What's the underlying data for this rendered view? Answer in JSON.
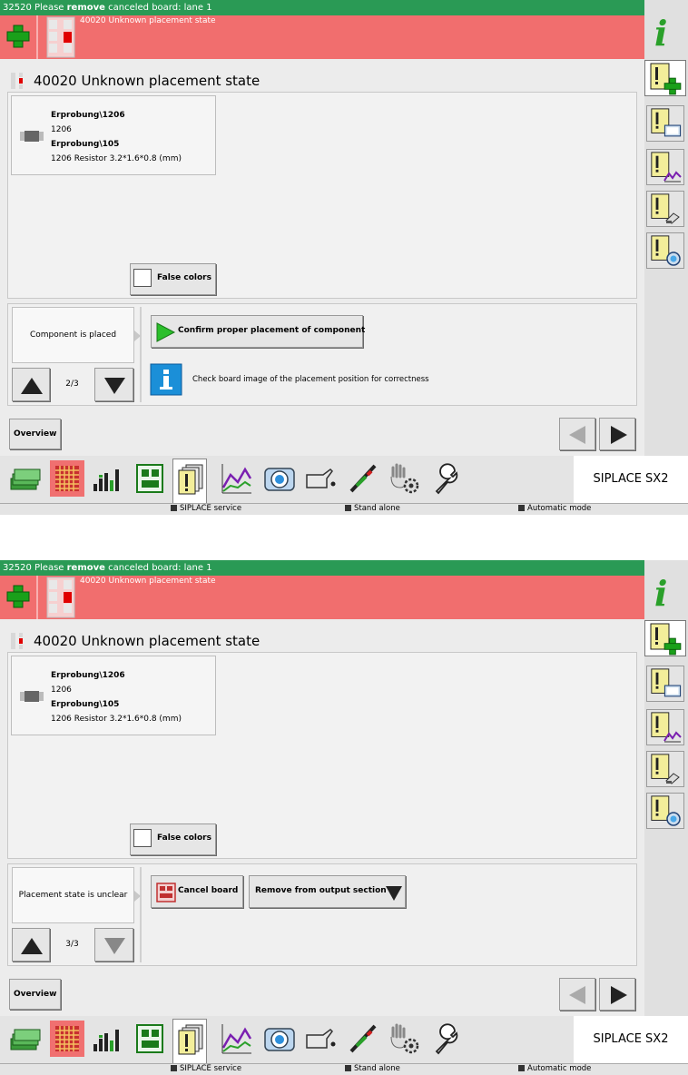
{
  "screens": [
    {
      "top_message": {
        "prefix": "32520 Please ",
        "bold": "remove",
        "suffix": " canceled board: lane 1"
      },
      "error_message": "40020 Unknown placement state",
      "title": "40020 Unknown placement state",
      "component": {
        "line1": "Erprobung\\1206",
        "line2": "1206",
        "line3": "Erprobung\\105",
        "line4": "1206 Resistor  3.2*1.6*0.8 (mm)"
      },
      "false_colors_label": "False colors",
      "state_text": "Component is placed",
      "pager": "2/3",
      "confirm_label": "Confirm proper placement of component",
      "check_text": "Check board image of the placement position for correctness",
      "overview_label": "Overview",
      "brand": "SIPLACE SX2",
      "status": [
        "SIPLACE service",
        "Stand alone",
        "Automatic mode"
      ]
    },
    {
      "top_message": {
        "prefix": "32520 Please ",
        "bold": "remove",
        "suffix": " canceled board: lane 1"
      },
      "error_message": "40020 Unknown placement state",
      "title": "40020 Unknown placement state",
      "component": {
        "line1": "Erprobung\\1206",
        "line2": "1206",
        "line3": "Erprobung\\105",
        "line4": "1206 Resistor  3.2*1.6*0.8 (mm)"
      },
      "false_colors_label": "False colors",
      "state_text": "Placement state is unclear",
      "pager": "3/3",
      "cancel_label": "Cancel board",
      "remove_label": "Remove from output section",
      "overview_label": "Overview",
      "brand": "SIPLACE SX2",
      "status": [
        "SIPLACE service",
        "Stand alone",
        "Automatic mode"
      ]
    }
  ],
  "colors": {
    "green_bar": "#2a9a55",
    "red_bar": "#f16e6e",
    "accent_yellow": "#f5f0a0"
  }
}
